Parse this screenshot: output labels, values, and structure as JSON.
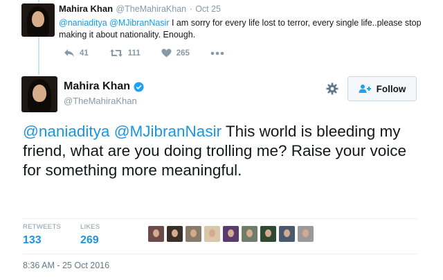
{
  "reply_tweet": {
    "name": "Mahira Khan",
    "handle": "@TheMahiraKhan",
    "separator": "·",
    "date": "Oct 25",
    "mention1": "@naniaditya",
    "mention2": "@MJibranNasir",
    "text": " I am sorry for every life lost to terror, every single life..please stop making it about nationality. Enough.",
    "replies": "41",
    "retweets": "111",
    "likes": "265"
  },
  "main_tweet": {
    "name": "Mahira Khan",
    "handle": "@TheMahiraKhan",
    "follow_label": "Follow",
    "mention1": "@naniaditya",
    "mention2": "@MJibranNasir",
    "text": " This world is bleeding my friend, what are you doing trolling me? Raise your voice for something more meaningful.",
    "retweets_label": "RETWEETS",
    "retweets_count": "133",
    "likes_label": "LIKES",
    "likes_count": "269",
    "timestamp": "8:36 AM - 25 Oct 2016"
  },
  "colors": {
    "link": "#1b95e0",
    "verified": "#1da1f2",
    "muted": "#8899a6"
  },
  "icons": [
    "reply-icon",
    "retweet-icon",
    "heart-icon",
    "more-icon",
    "verified-icon",
    "gear-icon",
    "follow-person-icon"
  ]
}
